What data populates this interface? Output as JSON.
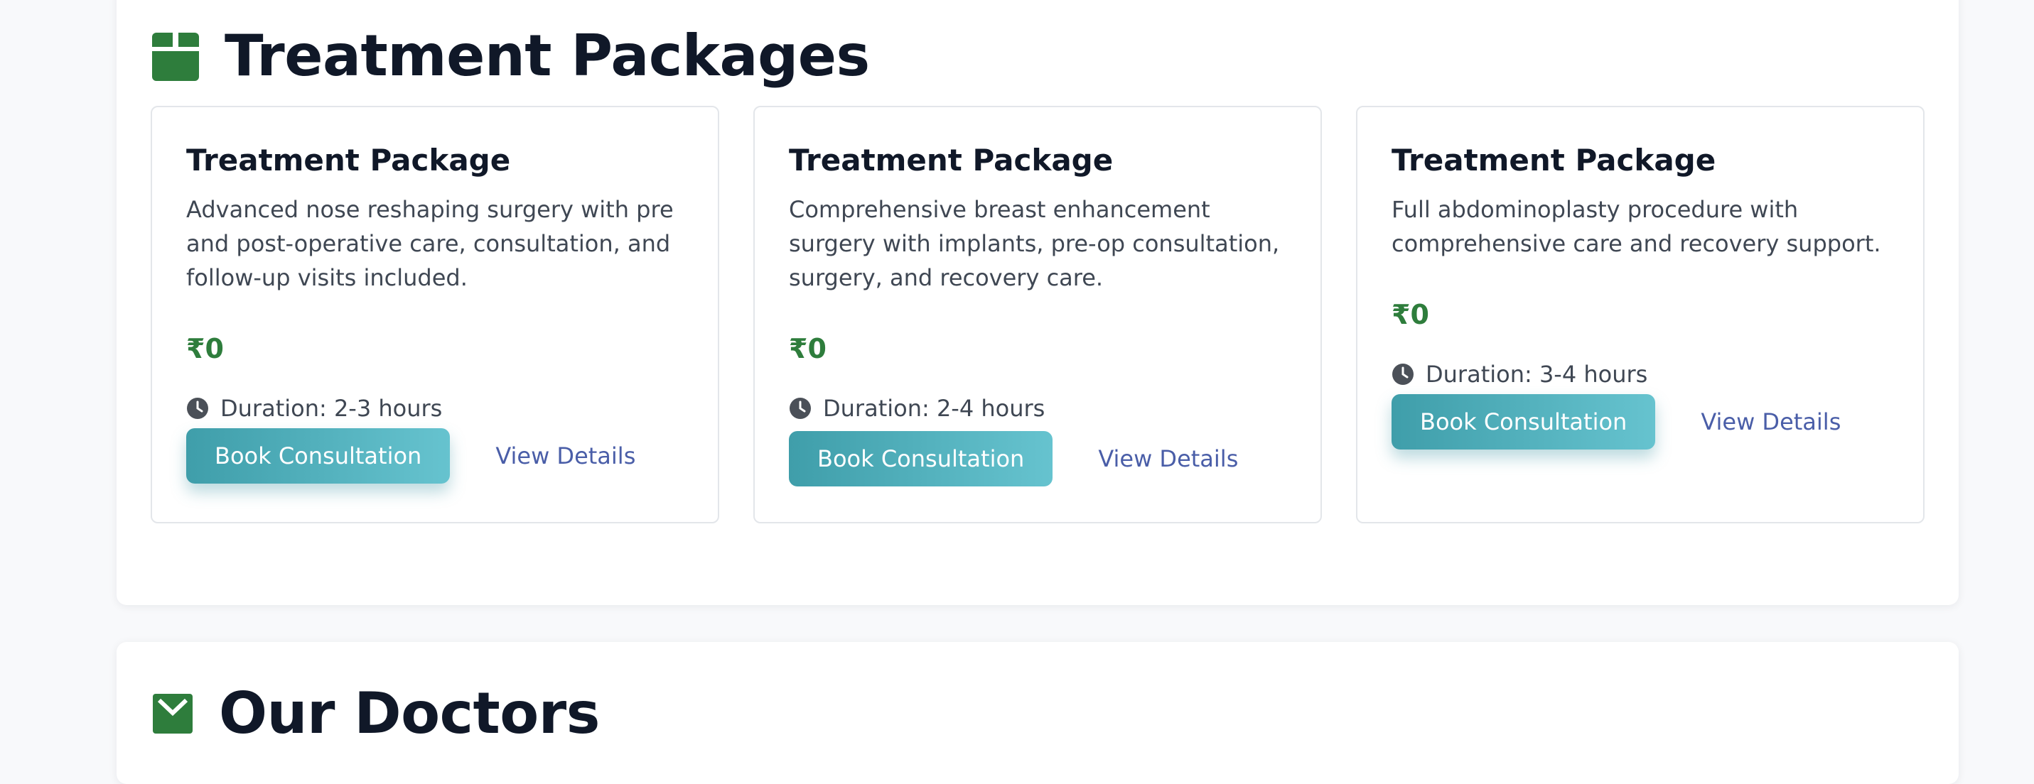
{
  "packages_section": {
    "title": "Treatment Packages",
    "icon": "box-icon",
    "accent_color": "#2e7d3c",
    "cards": [
      {
        "title": "Treatment Package",
        "description": "Advanced nose reshaping surgery with pre and post-operative care, consultation, and follow-up visits included.",
        "price": "₹0",
        "duration": "Duration: 2-3 hours",
        "book_label": "Book Consultation",
        "details_label": "View Details"
      },
      {
        "title": "Treatment Package",
        "description": "Comprehensive breast enhancement surgery with implants, pre-op consultation, surgery, and recovery care.",
        "price": "₹0",
        "duration": "Duration: 2-4 hours",
        "book_label": "Book Consultation",
        "details_label": "View Details"
      },
      {
        "title": "Treatment Package",
        "description": "Full abdominoplasty procedure with comprehensive care and recovery support.",
        "price": "₹0",
        "duration": "Duration: 3-4 hours",
        "book_label": "Book Consultation",
        "details_label": "View Details"
      }
    ]
  },
  "next_section": {
    "title": "Our Doctors",
    "icon": "doctor-icon"
  },
  "colors": {
    "button_gradient_start": "#3f9eaa",
    "button_gradient_end": "#66c3cf",
    "link": "#4a5ea8",
    "price": "#2e7d3c"
  }
}
